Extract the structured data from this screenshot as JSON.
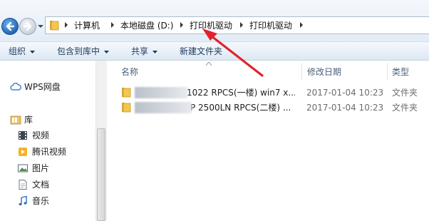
{
  "address_bar": {
    "crumbs": [
      "计算机",
      "本地磁盘 (D:)",
      "打印机驱动",
      "打印机驱动"
    ]
  },
  "toolbar": {
    "organize": "组织",
    "include_in_library": "包含到库中",
    "share": "共享",
    "new_folder": "新建文件夹"
  },
  "nav": {
    "wps": "WPS网盘",
    "library": "库",
    "videos": "视频",
    "tencent_video": "腾讯视频",
    "pictures": "图片",
    "documents": "文档",
    "music": "音乐"
  },
  "columns": {
    "name": "名称",
    "modified": "修改日期",
    "type": "类型"
  },
  "files": [
    {
      "name_visible": "1022 RPCS(一楼) win7 x...",
      "modified": "2017-01-04  10:23",
      "type": "文件夹"
    },
    {
      "name_visible": "P 2500LN RPCS(二楼) ...",
      "modified": "2017-01-04  10:23",
      "type": "文件夹"
    }
  ],
  "colors": {
    "annotation_arrow": "#e0232a",
    "folder": "#f2c74c",
    "toolbar_text": "#1e395b"
  },
  "icons": {
    "back": "back-arrow-icon",
    "forward": "forward-arrow-icon",
    "folder": "folder-icon",
    "cloud": "cloud-icon",
    "library": "library-icon",
    "video": "video-icon",
    "tencent": "tencent-video-icon",
    "picture": "picture-icon",
    "document": "document-icon",
    "music": "music-icon"
  }
}
